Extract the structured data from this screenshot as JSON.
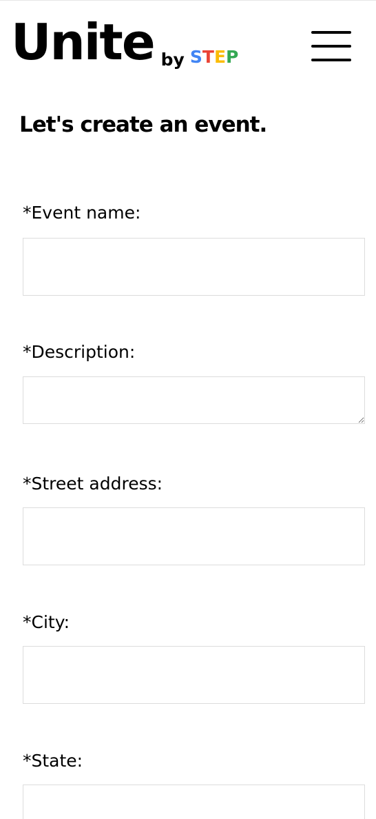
{
  "header": {
    "logo_main": "Unite",
    "logo_by": "by",
    "logo_step": [
      {
        "char": "S",
        "color": "#4285F4"
      },
      {
        "char": "T",
        "color": "#EA4335"
      },
      {
        "char": "E",
        "color": "#FBBC05"
      },
      {
        "char": "P",
        "color": "#34A853"
      }
    ],
    "menu_icon": "hamburger-menu-icon"
  },
  "main": {
    "title": "Let's create an event.",
    "fields": {
      "event_name": {
        "label": "*Event name:",
        "value": ""
      },
      "description": {
        "label": "*Description:",
        "value": ""
      },
      "street_address": {
        "label": "*Street address:",
        "value": ""
      },
      "city": {
        "label": "*City:",
        "value": ""
      },
      "state": {
        "label": "*State:",
        "value": ""
      }
    }
  }
}
